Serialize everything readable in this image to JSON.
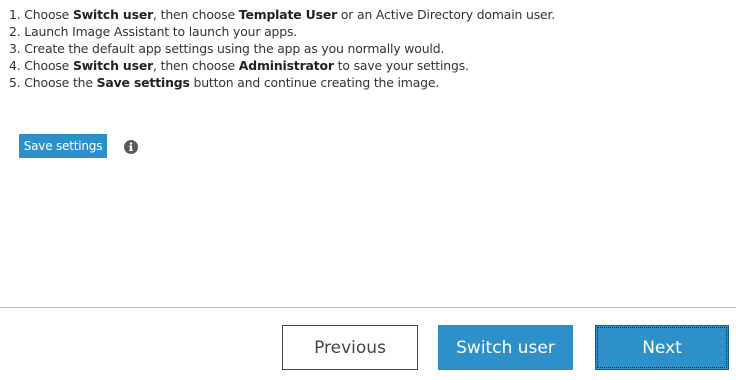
{
  "instructions": [
    {
      "prefix": "1. Choose ",
      "b1": "Switch user",
      "mid": ", then choose ",
      "b2": "Template User",
      "suffix": " or an Active Directory domain user."
    },
    {
      "prefix": "2. Launch Image Assistant to launch your apps.",
      "b1": "",
      "mid": "",
      "b2": "",
      "suffix": ""
    },
    {
      "prefix": "3. Create the default app settings using the app as you normally would.",
      "b1": "",
      "mid": "",
      "b2": "",
      "suffix": ""
    },
    {
      "prefix": "4. Choose ",
      "b1": "Switch user",
      "mid": ", then choose ",
      "b2": "Administrator",
      "suffix": " to save your settings."
    },
    {
      "prefix": "5. Choose the ",
      "b1": "Save settings",
      "mid": " button and continue creating the image.",
      "b2": "",
      "suffix": ""
    }
  ],
  "actions": {
    "save_settings_label": "Save settings",
    "info_icon": "info-circle-icon"
  },
  "footer": {
    "previous_label": "Previous",
    "switch_user_label": "Switch user",
    "next_label": "Next"
  },
  "colors": {
    "accent": "#2e90c9",
    "text": "#333333",
    "divider": "#bdbdbd"
  }
}
